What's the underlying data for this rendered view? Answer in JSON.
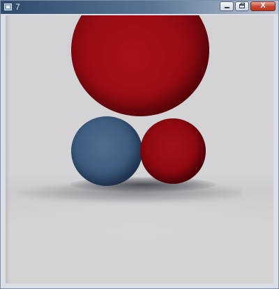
{
  "window": {
    "title": "7",
    "controls": {
      "minimize_icon": "minimize-icon",
      "maximize_icon": "restore-icon",
      "close_label": "X"
    },
    "colors": {
      "titlebar_start": "#2f4a6b",
      "titlebar_end": "#b9c6d6",
      "close_button": "#c5432f"
    }
  },
  "scene": {
    "colors": {
      "background": "#d3d2d4",
      "red_sphere": "#9a0c14",
      "blue_sphere": "#3f5d80"
    }
  }
}
